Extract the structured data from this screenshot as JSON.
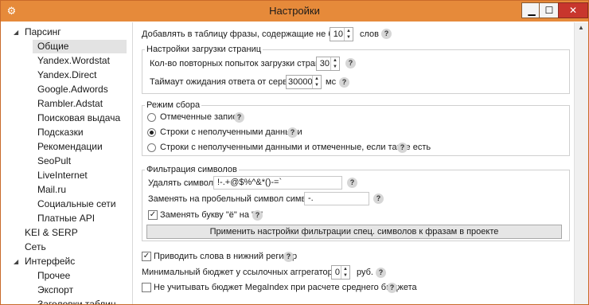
{
  "window": {
    "title": "Настройки",
    "icons": {
      "app": "gear-icon",
      "min": "minimize-icon",
      "max": "maximize-icon",
      "close": "close-icon"
    },
    "colors": {
      "titlebar": "#e68a3a",
      "close": "#c8362d"
    }
  },
  "tree": {
    "items": [
      {
        "label": "Парсинг",
        "level": 0,
        "expanded": true
      },
      {
        "label": "Общие",
        "level": 1,
        "selected": true
      },
      {
        "label": "Yandex.Wordstat",
        "level": 1
      },
      {
        "label": "Yandex.Direct",
        "level": 1
      },
      {
        "label": "Google.Adwords",
        "level": 1
      },
      {
        "label": "Rambler.Adstat",
        "level": 1
      },
      {
        "label": "Поисковая выдача",
        "level": 1
      },
      {
        "label": "Подсказки",
        "level": 1
      },
      {
        "label": "Рекомендации",
        "level": 1
      },
      {
        "label": "SeoPult",
        "level": 1
      },
      {
        "label": "LiveInternet",
        "level": 1
      },
      {
        "label": "Mail.ru",
        "level": 1
      },
      {
        "label": "Социальные сети",
        "level": 1
      },
      {
        "label": "Платные API",
        "level": 1
      },
      {
        "label": "KEI & SERP",
        "level": 0
      },
      {
        "label": "Сеть",
        "level": 0
      },
      {
        "label": "Интерфейс",
        "level": 0,
        "expanded": true
      },
      {
        "label": "Прочее",
        "level": 1
      },
      {
        "label": "Экспорт",
        "level": 1
      },
      {
        "label": "Заголовки таблиц",
        "level": 1
      }
    ]
  },
  "settings": {
    "add_phrases": {
      "label": "Добавлять в таблицу фразы, содержащие не более",
      "value": "10",
      "unit": "слов"
    },
    "loading": {
      "legend": "Настройки загрузки страниц",
      "retries": {
        "label": "Кол-во повторных попыток загрузки страниц:",
        "value": "30"
      },
      "timeout": {
        "label": "Таймаут ожидания ответа от сервиса:",
        "value": "30000",
        "unit": "мс"
      }
    },
    "mode": {
      "legend": "Режим сбора",
      "options": [
        {
          "label": "Отмеченные записи",
          "selected": false
        },
        {
          "label": "Строки с неполученными данными",
          "selected": true
        },
        {
          "label": "Строки с неполученными данными и отмеченные, если такие есть",
          "selected": false
        }
      ]
    },
    "filter": {
      "legend": "Фильтрация символов",
      "remove": {
        "label": "Удалять символы:",
        "value": "!-.+@$%^&*()-=`"
      },
      "replace": {
        "label": "Заменять на пробельный символ символы:",
        "value": "-."
      },
      "yo": {
        "label": "Заменять букву \"ё\" на \"е\"",
        "checked": true
      },
      "apply_button": "Применить настройки фильтрации спец. символов к фразам в проекте"
    },
    "lowercase": {
      "label": "Приводить слова в нижний регистр",
      "checked": true
    },
    "min_budget": {
      "label": "Минимальный бюджет у ссылочных аггрегаторов:",
      "value": "0",
      "unit": "руб."
    },
    "megaindex": {
      "label": "Не учитывать бюджет MegaIndex при расчете среднего бюджета",
      "checked": false
    }
  }
}
